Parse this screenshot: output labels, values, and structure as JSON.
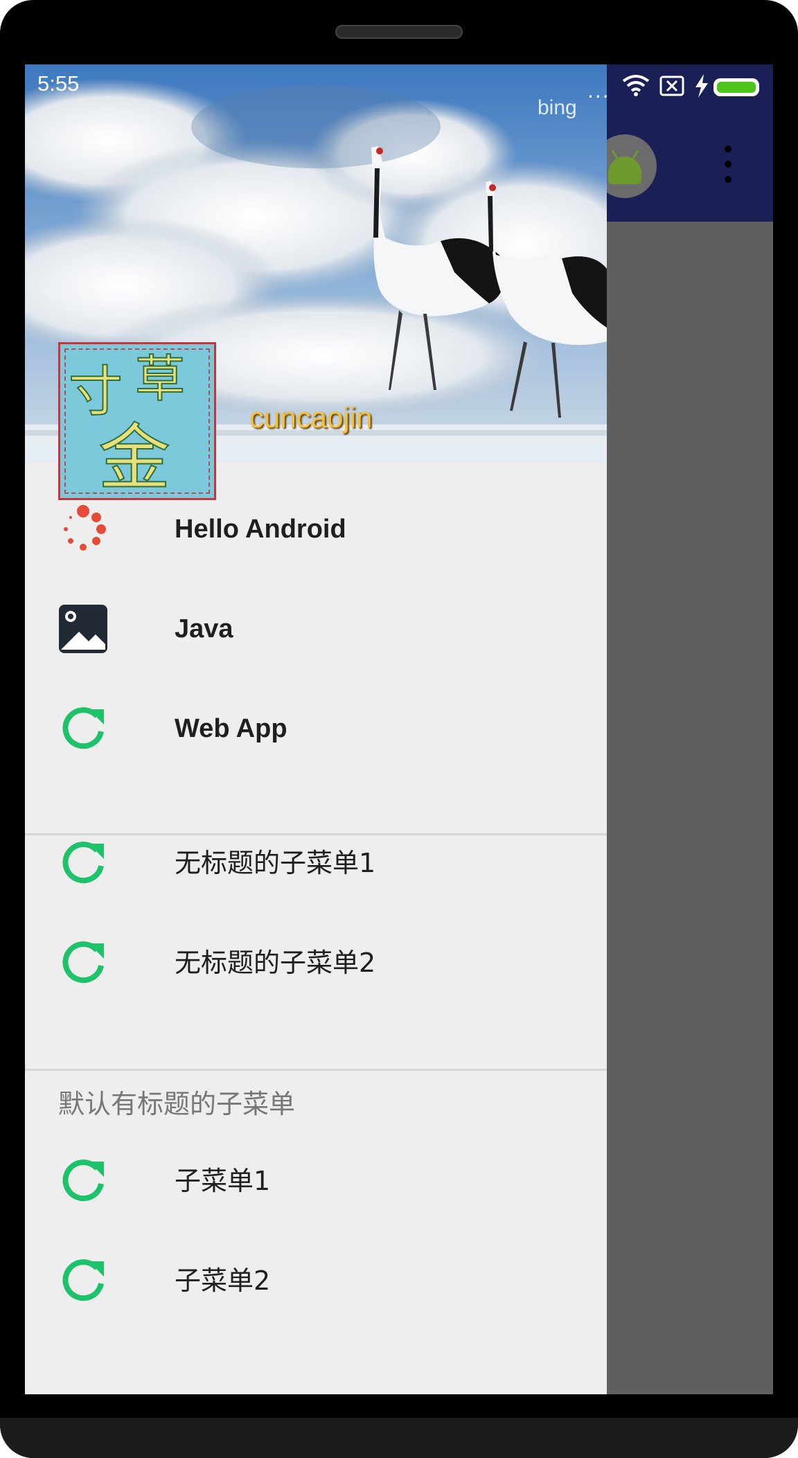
{
  "status_bar": {
    "time": "5:55",
    "more": "...",
    "battery_color": "#4cc41a"
  },
  "app_bar": {
    "background": "#1a1f55",
    "avatar_icon": "android-icon",
    "overflow_icon": "more-vert-icon"
  },
  "drawer": {
    "header": {
      "image_watermark": "bing",
      "username": "cuncaojin",
      "avatar_text": [
        "寸",
        "草",
        "金"
      ]
    },
    "items": [
      {
        "label": "Hello Android",
        "icon": "loading-spinner-icon"
      },
      {
        "label": "Java",
        "icon": "image-icon"
      },
      {
        "label": "Web App",
        "icon": "refresh-icon"
      }
    ],
    "untitled_group": [
      {
        "label": "无标题的子菜单1",
        "icon": "refresh-icon"
      },
      {
        "label": "无标题的子菜单2",
        "icon": "refresh-icon"
      }
    ],
    "titled_group": {
      "title": "默认有标题的子菜单",
      "items": [
        {
          "label": "子菜单1",
          "icon": "refresh-icon"
        },
        {
          "label": "子菜单2",
          "icon": "refresh-icon"
        }
      ]
    }
  },
  "colors": {
    "accent_green": "#1ec26b",
    "spinner_red": "#e84a3a",
    "drawer_bg": "#eeeeee",
    "scrim": "#5f5f5f"
  }
}
